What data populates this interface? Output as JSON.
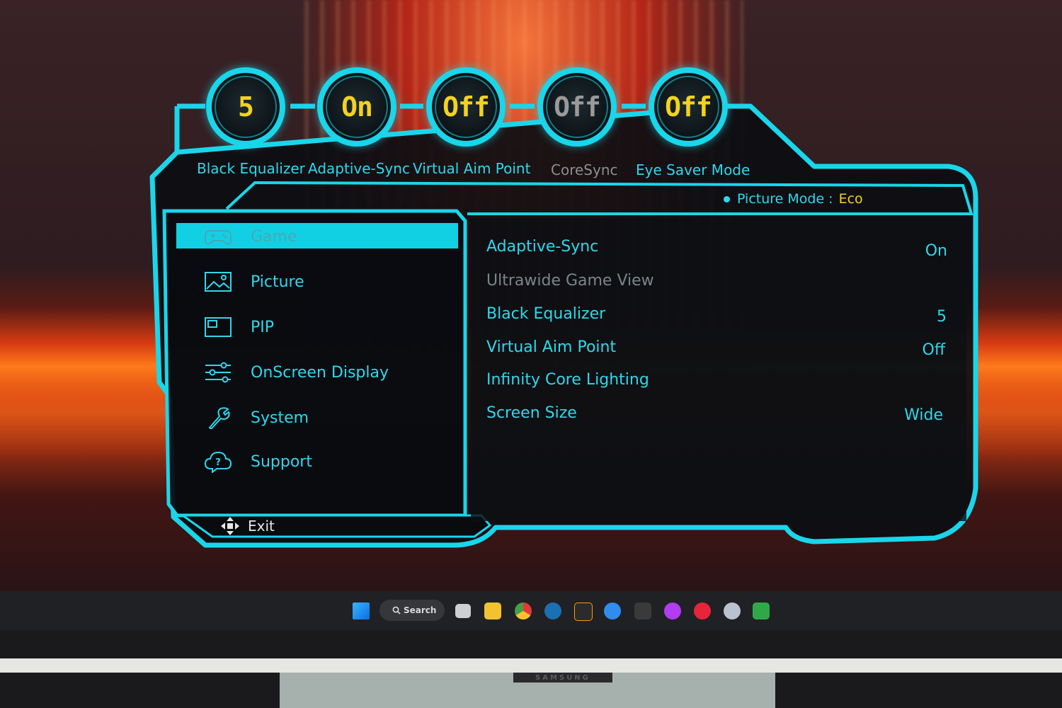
{
  "quick_dials": [
    {
      "value": "5",
      "label": "Black Equalizer",
      "enabled": true
    },
    {
      "value": "On",
      "label": "Adaptive-Sync",
      "enabled": true
    },
    {
      "value": "Off",
      "label": "Virtual Aim Point",
      "enabled": true
    },
    {
      "value": "Off",
      "label": "CoreSync",
      "enabled": false
    },
    {
      "value": "Off",
      "label": "Eye Saver Mode",
      "enabled": true
    }
  ],
  "picture_mode": {
    "label": "Picture Mode :",
    "value": "Eco"
  },
  "menu": {
    "items": [
      {
        "label": "Game",
        "icon": "gamepad-icon",
        "selected": true
      },
      {
        "label": "Picture",
        "icon": "picture-icon",
        "selected": false
      },
      {
        "label": "PIP",
        "icon": "pip-icon",
        "selected": false
      },
      {
        "label": "OnScreen Display",
        "icon": "sliders-icon",
        "selected": false
      },
      {
        "label": "System",
        "icon": "wrench-icon",
        "selected": false
      },
      {
        "label": "Support",
        "icon": "help-cloud-icon",
        "selected": false
      }
    ],
    "exit_label": "Exit"
  },
  "settings": [
    {
      "label": "Adaptive-Sync",
      "value": "On",
      "enabled": true
    },
    {
      "label": "Ultrawide Game View",
      "value": "",
      "enabled": false
    },
    {
      "label": "Black Equalizer",
      "value": "5",
      "enabled": true
    },
    {
      "label": "Virtual Aim Point",
      "value": "Off",
      "enabled": true
    },
    {
      "label": "Infinity Core Lighting",
      "value": "",
      "enabled": true
    },
    {
      "label": "Screen Size",
      "value": "Wide",
      "enabled": true
    }
  ],
  "taskbar": {
    "search_label": "Search",
    "icons": [
      "windows-start-icon",
      "task-view-icon",
      "file-explorer-icon",
      "chrome-icon",
      "steam-icon",
      "amazon-games-icon",
      "media-player-icon",
      "epic-games-icon",
      "circle-app-icon",
      "red-app-icon",
      "ubisoft-icon",
      "xbox-icon"
    ]
  },
  "brand": "SAMSUNG",
  "colors": {
    "accent": "#19d6ea",
    "value_yellow": "#f4d21e",
    "panel_bg": "#0e1216"
  }
}
